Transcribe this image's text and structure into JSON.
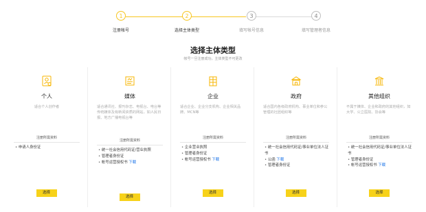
{
  "colors": {
    "accent": "#f7c51e",
    "link": "#1a73e8"
  },
  "stepper": {
    "steps": [
      {
        "num": "1",
        "label": "注册帐号",
        "status": "done",
        "icon": "check-circle"
      },
      {
        "num": "2",
        "label": "选择主体类型",
        "status": "done",
        "icon": "check-circle"
      },
      {
        "num": "3",
        "label": "填写帐号信息",
        "status": "todo"
      },
      {
        "num": "4",
        "label": "填写管理者信息",
        "status": "todo"
      }
    ]
  },
  "header": {
    "title": "选择主体类型",
    "subtitle": "帐号一旦注册成功，主体类型不可更改"
  },
  "cards": [
    {
      "icon": "person-id-icon",
      "title": "个人",
      "desc": "适合个人创作者",
      "req_title": "注册所需资料",
      "reqs": [
        "申请人身份证"
      ],
      "button": "选择"
    },
    {
      "icon": "media-icon",
      "title": "媒体",
      "desc": "适合通讯社、报刊杂志、电视台、电台等传统媒体及有新闻资质的网站，如人民日报、地方广播电视台等",
      "req_title": "注册所需资料",
      "reqs": [
        "统一社会信用代码证/营业执照",
        "管理者身份证",
        "帐号运营授权书"
      ],
      "link_text": "下载",
      "button": "选择"
    },
    {
      "icon": "enterprise-icon",
      "title": "企业",
      "desc": "适合企业、企业分支机构、企业相关品牌、MCN等",
      "req_title": "注册所需资料",
      "reqs": [
        "企业营业执照",
        "管理者身份证",
        "帐号运营授权书"
      ],
      "link_text": "下载",
      "button": "选择"
    },
    {
      "icon": "government-icon",
      "title": "政府",
      "desc": "适合国内各级政府机构、事业单位和参公管理的社团组织等",
      "req_title": "注册所需资料",
      "reqs": [
        "统一社会信用代码证/事业单位法人证书",
        "公函",
        "管理者身份证"
      ],
      "link_text": "下载",
      "button": "选择"
    },
    {
      "icon": "organization-icon",
      "title": "其他组织",
      "desc": "不属于媒体、企业和政府的其他组织，如大学、公立医院、协会等",
      "req_title": "注册所需资料",
      "reqs": [
        "统一社会信用代码证/事业单位法人证书",
        "管理者身份证",
        "帐号运营授权书"
      ],
      "link_text": "下载",
      "button": "选择"
    }
  ]
}
